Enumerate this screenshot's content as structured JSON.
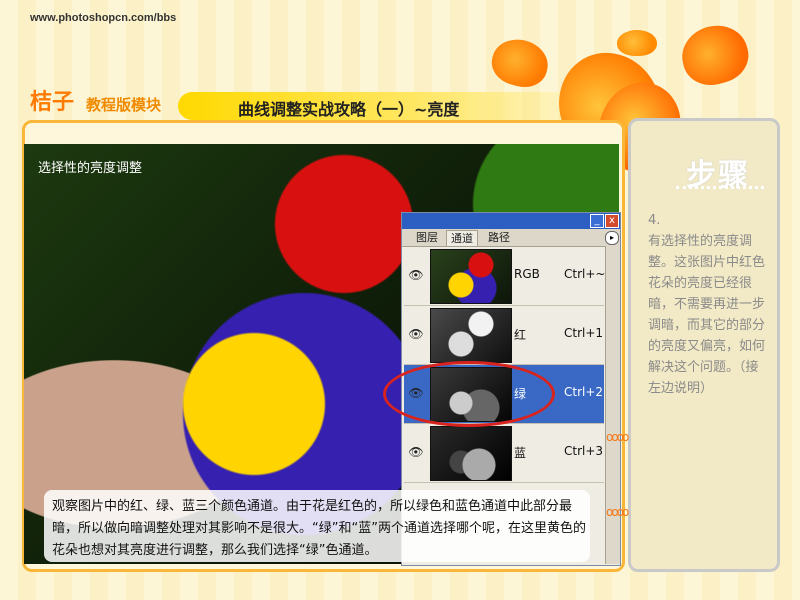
{
  "site": {
    "url": "www.photoshopcn.com/bbs"
  },
  "brand": {
    "main": "桔子",
    "sub": "教程版模块"
  },
  "page_title": "曲线调整实战攻略（一）~亮度",
  "photo": {
    "label": "选择性的亮度调整"
  },
  "caption": "观察图片中的红、绿、蓝三个颜色通道。由于花是红色的，所以绿色和蓝色通道中此部分最暗，所以做向暗调整处理对其影响不是很大。“绿”和“蓝”两个通道选择哪个呢，在这里黄色的花朵也想对其亮度进行调整，那么我们选择“绿”色通道。",
  "panel": {
    "tabs": [
      "图层",
      "通道",
      "路径"
    ],
    "active_tab": "通道",
    "min_label": "_",
    "close_label": "x",
    "menu_label": "▸",
    "channels": [
      {
        "name": "RGB",
        "shortcut": "Ctrl+~",
        "selected": false
      },
      {
        "name": "红",
        "shortcut": "Ctrl+1",
        "selected": false
      },
      {
        "name": "绿",
        "shortcut": "Ctrl+2",
        "selected": true
      },
      {
        "name": "蓝",
        "shortcut": "Ctrl+3",
        "selected": false
      }
    ],
    "eye_icon": "👁"
  },
  "steps": {
    "title": "步骤",
    "number": "4.",
    "text": "有选择性的亮度调整。这张图片中红色花朵的亮度已经很暗，不需要再进一步调暗，而其它的部分的亮度又偏亮，如何解决这个问题。（接左边说明）"
  },
  "rings": "oooo",
  "colors": {
    "accent": "#ff7a00",
    "selection": "#3a69c5",
    "highlight_ring": "#d8231e"
  }
}
